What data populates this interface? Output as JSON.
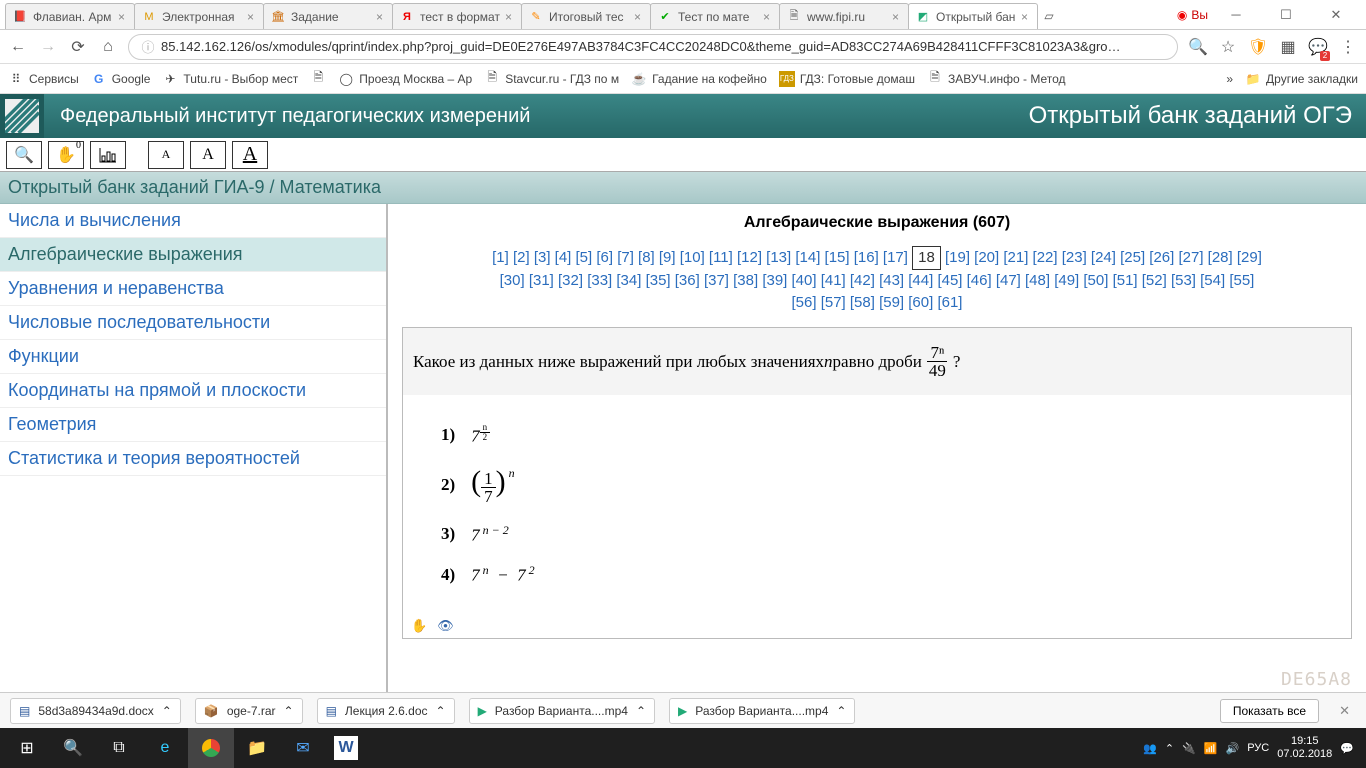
{
  "browser": {
    "tabs": [
      {
        "label": "Флавиан. Арм",
        "fav": "📕"
      },
      {
        "label": "Электронная",
        "fav": "M"
      },
      {
        "label": "Задание",
        "fav": "🏛"
      },
      {
        "label": "тест в формат",
        "fav": "Я"
      },
      {
        "label": "Итоговый тес",
        "fav": "✎"
      },
      {
        "label": "Тест по мате",
        "fav": "✔"
      },
      {
        "label": "www.fipi.ru",
        "fav": "🗎"
      },
      {
        "label": "Открытый бан",
        "fav": "◩",
        "active": true
      }
    ],
    "yandex_label": "Вы",
    "url": "85.142.162.126/os/xmodules/qprint/index.php?proj_guid=DE0E276E497AB3784C3FC4CC20248DC0&theme_guid=AD83CC274A69B428411CFFF3C81023A3&gro…",
    "info_icon": "ⓘ",
    "ext_badge": "2"
  },
  "bookmarks": {
    "apps": "Сервисы",
    "items": [
      {
        "icon": "G",
        "label": "Google"
      },
      {
        "icon": "✈",
        "label": "Tutu.ru - Выбор мест"
      },
      {
        "icon": "🗎",
        "label": ""
      },
      {
        "icon": "◯",
        "label": "Проезд Москва – Ар"
      },
      {
        "icon": "🗎",
        "label": "Stavcur.ru - ГДЗ по м"
      },
      {
        "icon": "☕",
        "label": "Гадание на кофейно"
      },
      {
        "icon": "🟧",
        "label": "ГДЗ: Готовые домаш"
      },
      {
        "icon": "🗎",
        "label": "ЗАВУЧ.инфо - Метод"
      }
    ],
    "other": "Другие закладки"
  },
  "page": {
    "header_left": "Федеральный институт педагогических измерений",
    "header_right": "Открытый банк заданий ОГЭ",
    "breadcrumb": "Открытый банк заданий ГИА-9 / Математика",
    "hand_index": "0",
    "categories": [
      "Числа и вычисления",
      "Алгебраические выражения",
      "Уравнения и неравенства",
      "Числовые последовательности",
      "Функции",
      "Координаты на прямой и плоскости",
      "Геометрия",
      "Статистика и теория вероятностей"
    ],
    "active_category": 1,
    "main_title": "Алгебраические выражения (607)",
    "pages_row1": "[1] [2] [3] [4] [5] [6] [7] [8] [9] [10] [11] [12] [13] [14] [15] [16] [17]",
    "current_page": "18",
    "pages_row1b": "[19] [20] [21] [22] [23] [24] [25] [26] [27] [28] [29]",
    "pages_row2": "[30] [31] [32] [33] [34] [35] [36] [37] [38] [39] [40] [41] [42] [43] [44] [45] [46] [47] [48] [49] [50] [51] [52] [53] [54] [55]",
    "pages_row3": "[56] [57] [58] [59] [60] [61]",
    "question_text_a": "Какое из данных ниже выражений при любых значениях ",
    "question_var": "n",
    "question_text_b": " равно дроби ",
    "question_frac_top": "7ⁿ",
    "question_frac_bot": "49",
    "question_text_c": " ?",
    "options": {
      "o1": "1)",
      "o2": "2)",
      "o3": "3)",
      "o4": "4)"
    },
    "question_id": "DE65A8"
  },
  "downloads": {
    "items": [
      "58d3a89434a9d.docx",
      "oge-7.rar",
      "Лекция 2.6.doc",
      "Разбор Варианта....mp4",
      "Разбор Варианта....mp4"
    ],
    "show_all": "Показать все"
  },
  "taskbar": {
    "lang": "РУС",
    "time": "19:15",
    "date": "07.02.2018"
  }
}
